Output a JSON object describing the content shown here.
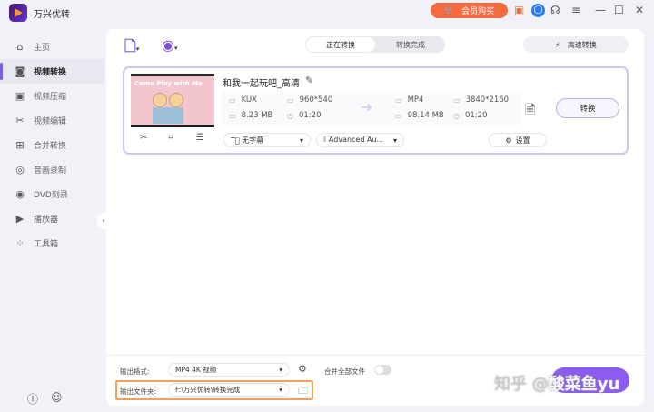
{
  "app": {
    "title": "万兴优转",
    "buy_label": "会员购买"
  },
  "sidebar": {
    "items": [
      {
        "label": "主页",
        "icon": "home-icon"
      },
      {
        "label": "视频转换",
        "icon": "convert-icon",
        "active": true
      },
      {
        "label": "视频压缩",
        "icon": "compress-icon"
      },
      {
        "label": "视频编辑",
        "icon": "scissors-icon"
      },
      {
        "label": "合并转换",
        "icon": "merge-icon"
      },
      {
        "label": "音画录制",
        "icon": "record-icon"
      },
      {
        "label": "DVD刻录",
        "icon": "dvd-icon"
      },
      {
        "label": "播放器",
        "icon": "player-icon"
      },
      {
        "label": "工具箱",
        "icon": "toolbox-icon"
      }
    ]
  },
  "header": {
    "tabs": [
      "正在转换",
      "转换完成"
    ],
    "fast_label": "高速转换"
  },
  "file": {
    "name": "和我一起玩吧_高清",
    "thumb_text": "Come Play with Me",
    "source": {
      "format": "KUX",
      "resolution": "960*540",
      "size": "8.23 MB",
      "duration": "01:20"
    },
    "target": {
      "format": "MP4",
      "resolution": "3840*2160",
      "size": "98.14 MB",
      "duration": "01:20"
    },
    "subtitle": "无字幕",
    "audio": "Advanced Au...",
    "settings_label": "设置",
    "convert_label": "转换"
  },
  "bottom": {
    "format_label": "输出格式:",
    "format_value": "MP4 4K 视频",
    "merge_label": "合并全部文件",
    "folder_label": "输出文件夹:",
    "folder_value": "F:\\万兴优转\\转换完成"
  },
  "watermark": {
    "prefix": "知乎 @",
    "name": "酸菜鱼yu"
  }
}
